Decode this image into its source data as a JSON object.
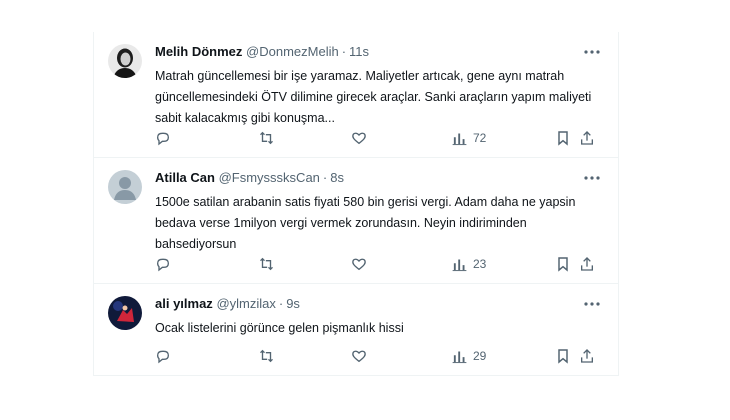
{
  "tweets": [
    {
      "name": "Melih Dönmez",
      "handle": "@DonmezMelih",
      "time": "11s",
      "text": "Matrah güncellemesi bir işe yaramaz. Maliyetler artıcak, gene aynı matrah güncellemesindeki ÖTV dilimine girecek araçlar. Sanki araçların yapım maliyeti sabit kalacakmış gibi konuşma...",
      "views": "72"
    },
    {
      "name": "Atilla Can",
      "handle": "@FsmysssksCan",
      "time": "8s",
      "text": "1500e satilan arabanin satis fiyati 580 bin gerisi vergi. Adam daha ne yapsin bedava verse 1milyon vergi vermek zorundasın. Neyin indiriminden bahsediyorsun",
      "views": "23"
    },
    {
      "name": "ali yılmaz",
      "handle": "@ylmzilax",
      "time": "9s",
      "text": "Ocak listelerini görünce gelen pişmanlık hissi",
      "views": "29"
    }
  ],
  "icons": {
    "reply": "reply-icon",
    "retweet": "retweet-icon",
    "like": "like-icon",
    "views": "views-icon",
    "bookmark": "bookmark-icon",
    "share": "share-icon",
    "more": "more-icon"
  },
  "colors": {
    "text": "#0f1419",
    "secondary": "#536471",
    "divider": "#eff3f4"
  }
}
